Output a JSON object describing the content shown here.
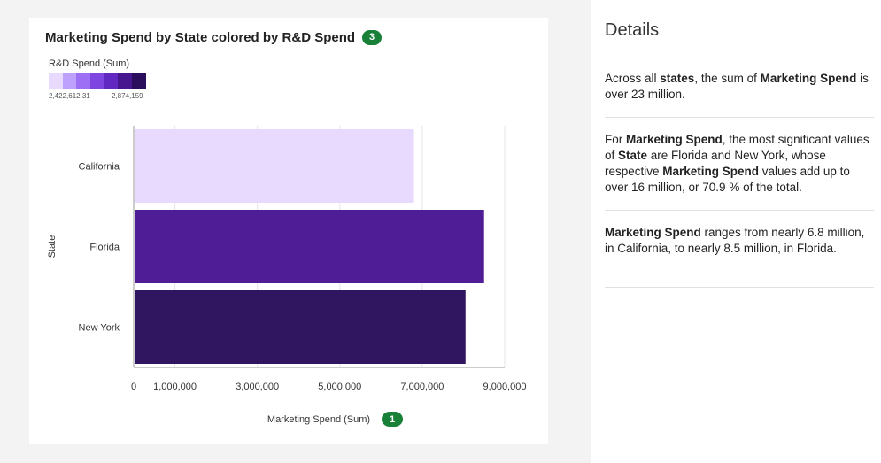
{
  "chart_data": {
    "type": "bar",
    "orientation": "horizontal",
    "title": "Marketing Spend by State colored by R&D Spend",
    "title_badge": "3",
    "categories": [
      "California",
      "Florida",
      "New York"
    ],
    "values": [
      6800000,
      8500000,
      8050000
    ],
    "color_values": [
      2422612.31,
      2790000,
      2874159
    ],
    "bar_colors": [
      "#e8daff",
      "#4f1e96",
      "#301660"
    ],
    "xlabel": "Marketing Spend (Sum)",
    "xlabel_badge": "1",
    "ylabel": "State",
    "xlim": [
      0,
      9000000
    ],
    "x_ticks": [
      0,
      1000000,
      3000000,
      5000000,
      7000000,
      9000000
    ],
    "x_tick_labels": [
      "0",
      "1,000,000",
      "3,000,000",
      "5,000,000",
      "7,000,000",
      "9,000,000"
    ],
    "grid": true,
    "legend": {
      "title": "R&D Spend (Sum)",
      "min_label": "2,422,612.31",
      "max_label": "2,874,159",
      "colors": [
        "#e8daff",
        "#bea1fc",
        "#9d6ff5",
        "#7e45e0",
        "#6128c2",
        "#46178f",
        "#2c0f5c"
      ],
      "placement": "top-left"
    }
  },
  "details": {
    "title": "Details",
    "insight1": {
      "p1": "Across all ",
      "b1": "states",
      "p2": ", the sum of ",
      "b2": "Marketing Spend",
      "p3": " is over 23 million."
    },
    "insight2": {
      "p1": "For ",
      "b1": "Marketing Spend",
      "p2": ", the most significant values of ",
      "b2": "State",
      "p3": " are Florida and New York, whose respective ",
      "b3": "Marketing Spend",
      "p4": " values add up to over 16 million, or 70.9 % of the total."
    },
    "insight3": {
      "b1": "Marketing Spend",
      "p1": " ranges from nearly 6.8 million, in California, to nearly 8.5 million, in Florida."
    }
  }
}
